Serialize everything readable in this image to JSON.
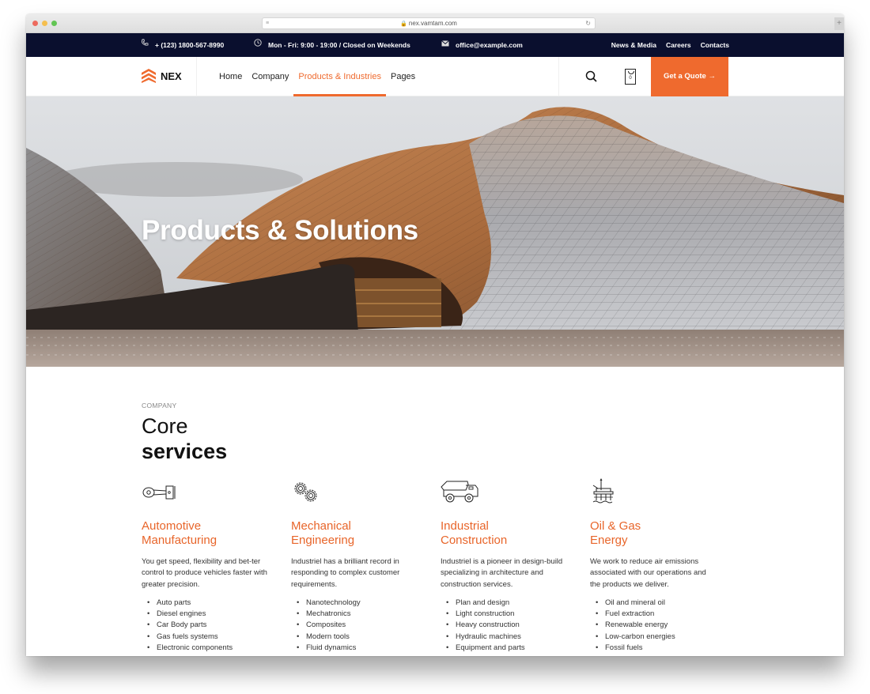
{
  "browser": {
    "url": "nex.vamtam.com",
    "lock_icon": "🔒",
    "reload_icon": "↻",
    "new_tab_icon": "+"
  },
  "topbar": {
    "phone": "+ (123) 1800-567-8990",
    "hours": "Mon - Fri: 9:00 - 19:00 / Closed on Weekends",
    "email": "office@example.com",
    "links": [
      "News & Media",
      "Careers",
      "Contacts"
    ]
  },
  "nav": {
    "brand": "NEX",
    "items": [
      {
        "label": "Home",
        "active": false
      },
      {
        "label": "Company",
        "active": false
      },
      {
        "label": "Products & Industries",
        "active": true
      },
      {
        "label": "Pages",
        "active": false
      }
    ],
    "cart_count": "0",
    "quote_label": "Get a Quote →",
    "accent": "#ef6a2e"
  },
  "hero": {
    "title": "Products & Solutions"
  },
  "section": {
    "eyebrow": "COMPANY",
    "title_light": "Core",
    "title_bold": "services",
    "services": [
      {
        "icon": "piston-icon",
        "title_line1": "Automotive",
        "title_line2": "Manufacturing",
        "description": "You get speed, flexibility and bet-ter control to produce vehicles faster with greater precision.",
        "items": [
          "Auto parts",
          "Diesel engines",
          "Car Body parts",
          "Gas fuels systems",
          "Electronic components"
        ]
      },
      {
        "icon": "gears-icon",
        "title_line1": "Mechanical",
        "title_line2": "Engineering",
        "description": "Industriel has a brilliant record in responding to complex customer requirements.",
        "items": [
          "Nanotechnology",
          "Mechatronics",
          "Composites",
          "Modern tools",
          "Fluid dynamics"
        ]
      },
      {
        "icon": "dump-truck-icon",
        "title_line1": "Industrial",
        "title_line2": "Construction",
        "description": "Industriel is a pioneer in design-build specializing in architecture and construction services.",
        "items": [
          "Plan and design",
          "Light construction",
          "Heavy construction",
          "Hydraulic machines",
          "Equipment and parts"
        ]
      },
      {
        "icon": "oil-rig-icon",
        "title_line1": "Oil & Gas",
        "title_line2": "Energy",
        "description": "We work to reduce air emissions associated with our operations and the products we deliver.",
        "items": [
          "Oil and mineral oil",
          "Fuel extraction",
          "Renewable energy",
          "Low-carbon energies",
          "Fossil fuels"
        ]
      }
    ]
  }
}
